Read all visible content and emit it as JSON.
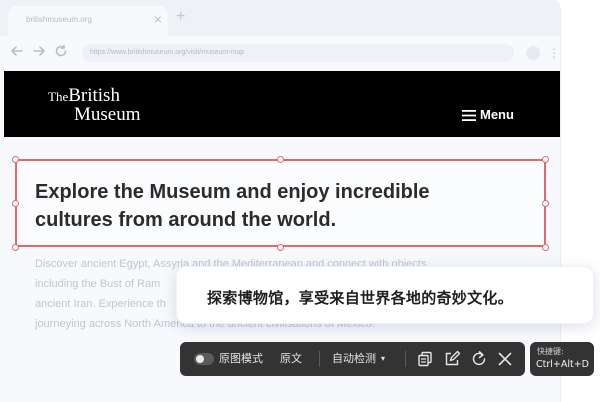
{
  "browser": {
    "tab_title": "britishmuseum.org",
    "tab_close": "×",
    "new_tab": "+",
    "url": "https://www.britishmuseum.org/visit/museum-map",
    "more": "⋮"
  },
  "site": {
    "logo_line1_prefix": "The",
    "logo_line1_main": "British",
    "logo_line2": "Museum",
    "menu_label": "Menu",
    "headline": "Explore the Museum and enjoy incredible cultures from around the world.",
    "body_lines": [
      "Discover ancient Egypt, Assyria and the Mediterranean and connect with objects",
      "including the Bust of Ram",
      "ancient Iran. Experience th",
      "journeying across North America to the ancient civilisations of Mexico."
    ]
  },
  "translation": {
    "text": "探索博物馆，享受来自世界各地的奇妙文化。"
  },
  "toolbar": {
    "original_mode": "原图模式",
    "source_text": "原文",
    "auto_detect": "自动检测",
    "caret": "▾"
  },
  "shortcut": {
    "title": "快捷键:",
    "keys": "Ctrl+Alt+D"
  },
  "colors": {
    "selection": "#e3686b",
    "toolbar_bg": "#333333",
    "header_bg": "#000000"
  }
}
